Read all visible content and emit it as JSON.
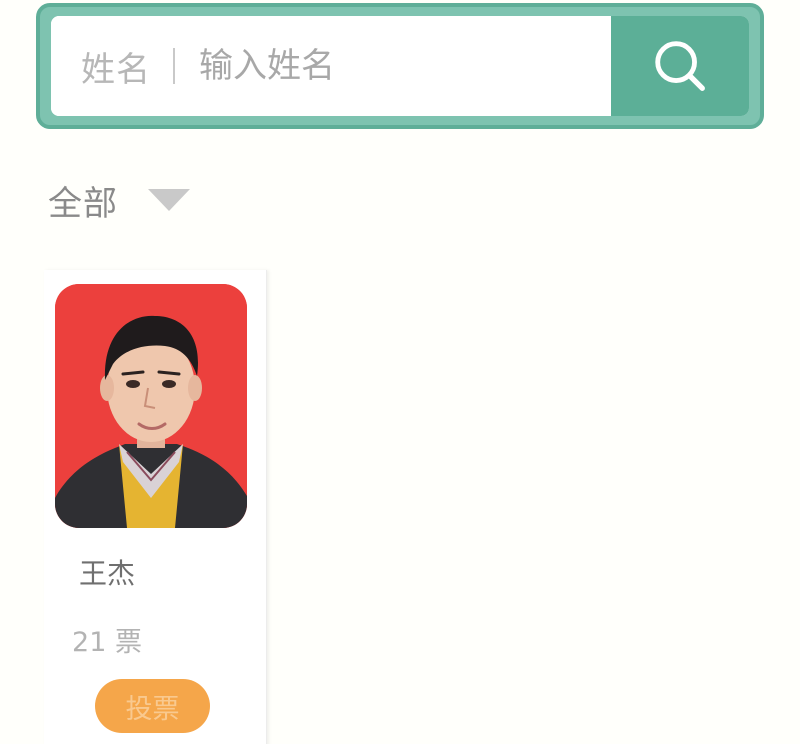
{
  "search": {
    "field_label": "姓名",
    "placeholder": "输入姓名",
    "value": "",
    "button_icon": "search-icon",
    "accent_color": "#5caf97"
  },
  "filter": {
    "selected": "全部",
    "icon": "caret-down-icon"
  },
  "candidates": [
    {
      "name": "王杰",
      "votes": "21",
      "votes_unit": "票",
      "vote_button_label": "投票",
      "button_color": "#f5a64a"
    }
  ]
}
